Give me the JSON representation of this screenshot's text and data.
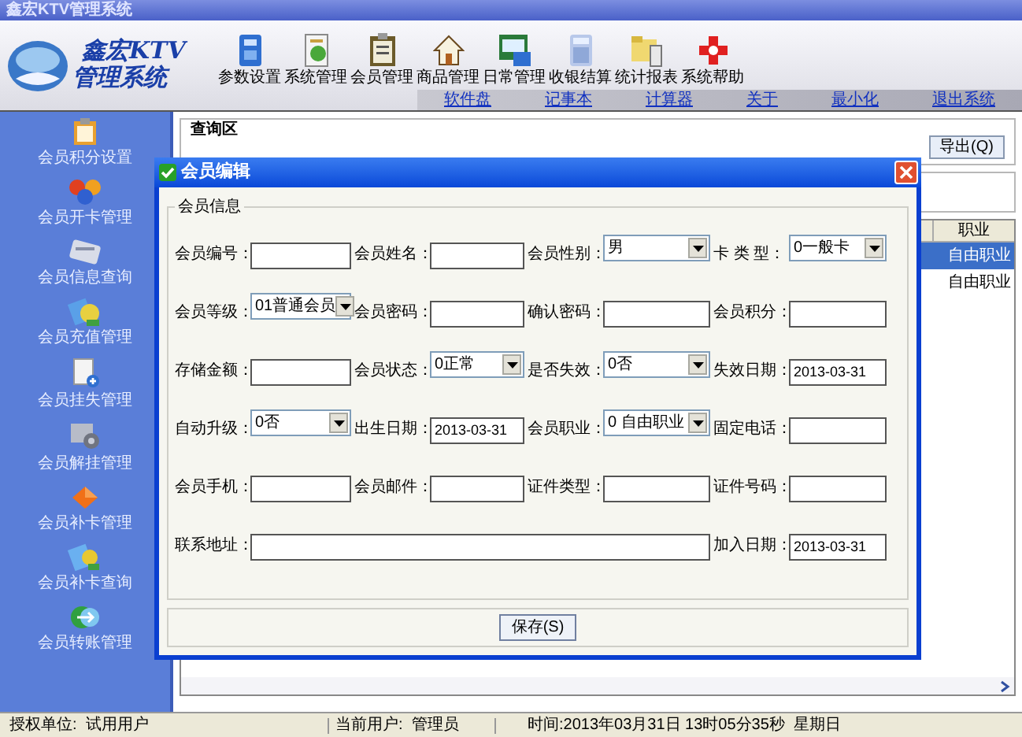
{
  "window": {
    "title": "鑫宏KTV管理系统"
  },
  "logo": {
    "line_1": "鑫宏KTV",
    "line_2": "管理系统"
  },
  "toolbar": [
    {
      "label": "参数设置"
    },
    {
      "label": "系统管理"
    },
    {
      "label": "会员管理"
    },
    {
      "label": "商品管理"
    },
    {
      "label": "日常管理"
    },
    {
      "label": "收银结算"
    },
    {
      "label": "统计报表"
    },
    {
      "label": "系统帮助"
    }
  ],
  "links": [
    "软件盘",
    "记事本",
    "计算器",
    "关于",
    "最小化",
    "退出系统"
  ],
  "sidebar": {
    "items": [
      {
        "label": "会员积分设置"
      },
      {
        "label": "会员开卡管理"
      },
      {
        "label": "会员信息查询"
      },
      {
        "label": "会员充值管理"
      },
      {
        "label": "会员挂失管理"
      },
      {
        "label": "会员解挂管理"
      },
      {
        "label": "会员补卡管理"
      },
      {
        "label": "会员补卡查询"
      },
      {
        "label": "会员转账管理"
      }
    ]
  },
  "query_area": {
    "title": "查询区",
    "export_button": "导出(Q)"
  },
  "grid": {
    "columns": [
      "职业"
    ],
    "rows": [
      {
        "cells": [
          "自由职业"
        ],
        "selected": true
      },
      {
        "cells": [
          "自由职业"
        ],
        "selected": false
      }
    ]
  },
  "dialog": {
    "title": "会员编辑",
    "group": "会员信息",
    "fields": [
      {
        "label": "会员编号：",
        "kind": "text"
      },
      {
        "label": "会员姓名：",
        "kind": "text"
      },
      {
        "label": "会员性别：",
        "kind": "select",
        "value": "男"
      },
      {
        "label": "卡 类 型：",
        "kind": "select",
        "value": "0一般卡"
      },
      {
        "label": "会员等级：",
        "kind": "select",
        "value": "01普通会员"
      },
      {
        "label": "会员密码：",
        "kind": "text"
      },
      {
        "label": "确认密码：",
        "kind": "text"
      },
      {
        "label": "会员积分：",
        "kind": "text"
      },
      {
        "label": "存储金额：",
        "kind": "text"
      },
      {
        "label": "会员状态：",
        "kind": "select",
        "value": "0正常"
      },
      {
        "label": "是否失效：",
        "kind": "select",
        "value": "0否"
      },
      {
        "label": "失效日期：",
        "kind": "date",
        "value": "2013-03-31"
      },
      {
        "label": "自动升级：",
        "kind": "select",
        "value": "0否"
      },
      {
        "label": "出生日期：",
        "kind": "date",
        "value": "2013-03-31"
      },
      {
        "label": "会员职业：",
        "kind": "select",
        "value": "0 自由职业"
      },
      {
        "label": "固定电话：",
        "kind": "text"
      },
      {
        "label": "会员手机：",
        "kind": "text"
      },
      {
        "label": "会员邮件：",
        "kind": "text"
      },
      {
        "label": "证件类型：",
        "kind": "text"
      },
      {
        "label": "证件号码：",
        "kind": "text"
      },
      {
        "label": "联系地址：",
        "kind": "wide"
      },
      {
        "label": "加入日期：",
        "kind": "date",
        "value": "2013-03-31"
      }
    ],
    "save_button": "保存(S)"
  },
  "status_bar": {
    "unit": "授权单位:  试用用户",
    "user": "当前用户:  管理员",
    "time": "时间:2013年03月31日 13时05分35秒  星期日"
  }
}
